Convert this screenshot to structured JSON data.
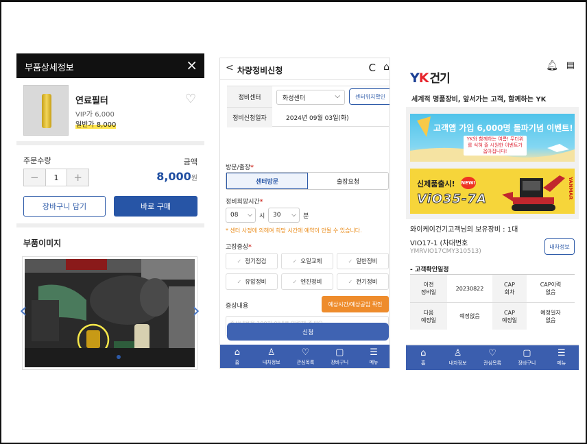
{
  "panel1": {
    "header_title": "부품상세정보",
    "close_icon": "×",
    "product_name": "연료필터",
    "vip_price": "VIP가 6,000",
    "normal_price": "일반가 8,000",
    "qty_label": "주문수량",
    "amount_label": "금액",
    "qty_minus": "−",
    "qty_value": "1",
    "qty_plus": "+",
    "total_price": "8,000",
    "currency": "원",
    "cart_button": "장바구니 담기",
    "buy_button": "바로 구매",
    "image_section": "부품이미지",
    "prev_arrow": "‹",
    "next_arrow": "›"
  },
  "panel2": {
    "back": "<",
    "title": "차량정비신청",
    "refresh_icon": "C",
    "home_icon": "⌂",
    "center_label": "정비센터",
    "center_value": "화성센터",
    "center_location_button": "센터위치확인",
    "date_label": "정비신청일자",
    "date_value": "2024년 09월 03일(화)",
    "visit_label": "방문/출장",
    "visit_options": [
      "센터방문",
      "출장요청"
    ],
    "time_label": "정비희망시간",
    "hour_value": "08",
    "hour_unit": "시",
    "minute_value": "30",
    "minute_unit": "분",
    "warning": "* 센터 사정에 의해여 희망 시간에 예약이 안될 수 있습니다.",
    "symptom_label": "고장증상",
    "symptoms": [
      "정기점검",
      "오일교체",
      "일반정비",
      "유압정비",
      "엔진정비",
      "전기정비"
    ],
    "content_label": "증상내용",
    "estimate_button": "예상시간/예상공임 확인",
    "textarea_placeholder": "증상내용을 100자 이내로 입력해 주세요",
    "submit_button": "신청",
    "nav": [
      "홈",
      "내차정보",
      "관심목록",
      "장바구니",
      "메뉴"
    ],
    "required_mark": "*"
  },
  "panel3": {
    "logo_y": "Y",
    "logo_k": "K",
    "logo_kr": "건기",
    "slogan": "세계적 명품장비, 앞서가는 고객, 함께하는 YK",
    "banner1_title": "고객앱 가입 6,000명 돌파기념 이벤트!",
    "banner1_sub": "YK와 함께하는 여름! 무더위를 식혀 줄 시원한 이벤트가 옵아집니다!",
    "banner2_title": "신제품출시!",
    "banner2_badge": "NEW!",
    "banner2_model": "ViO35-7A",
    "banner2_brand": "YANMAR",
    "equipment_count": "와이케이건기고객님의 보유장비 : 1대",
    "model": "VIO17-1 (차대번호",
    "serial": "YMRVIO17CMY310513)",
    "my_car_button": "내차정보",
    "check_schedule": "- 고객확인일정",
    "table": [
      [
        "이전\n정비일",
        "20230822",
        "CAP\n회차",
        "CAP이력\n없음"
      ],
      [
        "다음\n예정일",
        "예정없음",
        "CAP\n예정일",
        "예정일자\n없음"
      ]
    ],
    "nav": [
      "홈",
      "내차정보",
      "관심목록",
      "장바구니",
      "메뉴"
    ]
  },
  "colors": {
    "primary": "#2755a6",
    "nav": "#3b5eae",
    "orange": "#ee8c2c",
    "banner_blue": "#4fc3ea",
    "banner_yellow": "#f6d53a"
  }
}
